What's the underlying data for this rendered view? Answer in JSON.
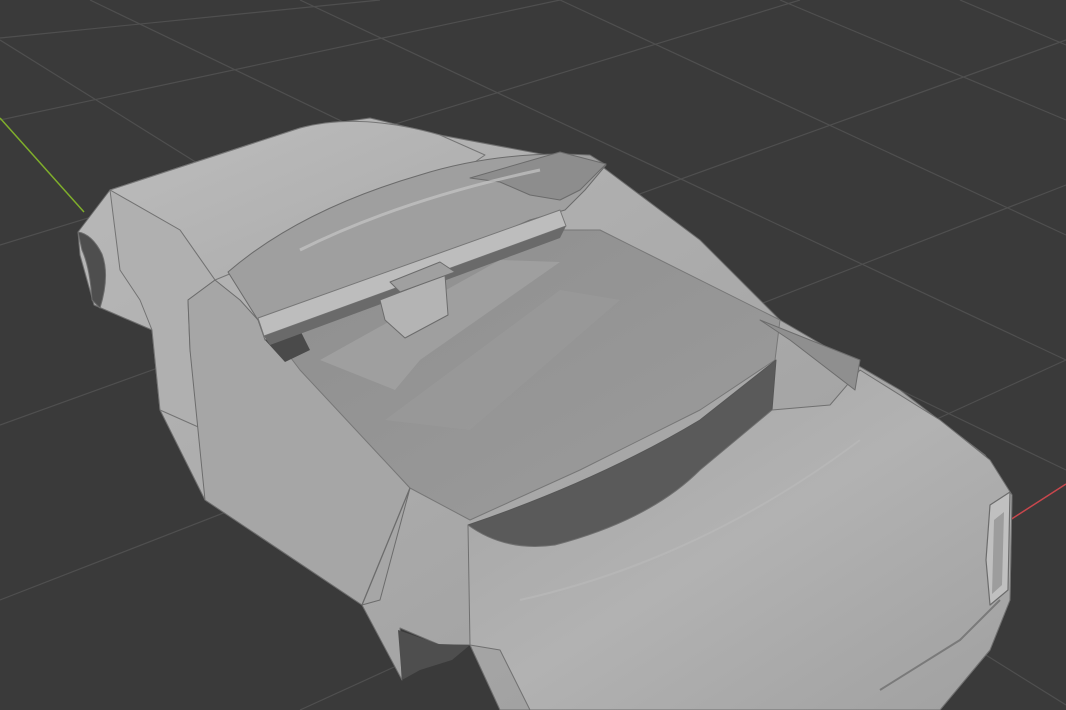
{
  "viewport": {
    "background": "#3a3a3a",
    "grid_color": "#505050",
    "axis_x_color": "#c8474d",
    "axis_y_color": "#7fae2b"
  },
  "object": {
    "kind": "car-body-mesh",
    "shading": "solid",
    "base_color": "#a9a9a9"
  }
}
